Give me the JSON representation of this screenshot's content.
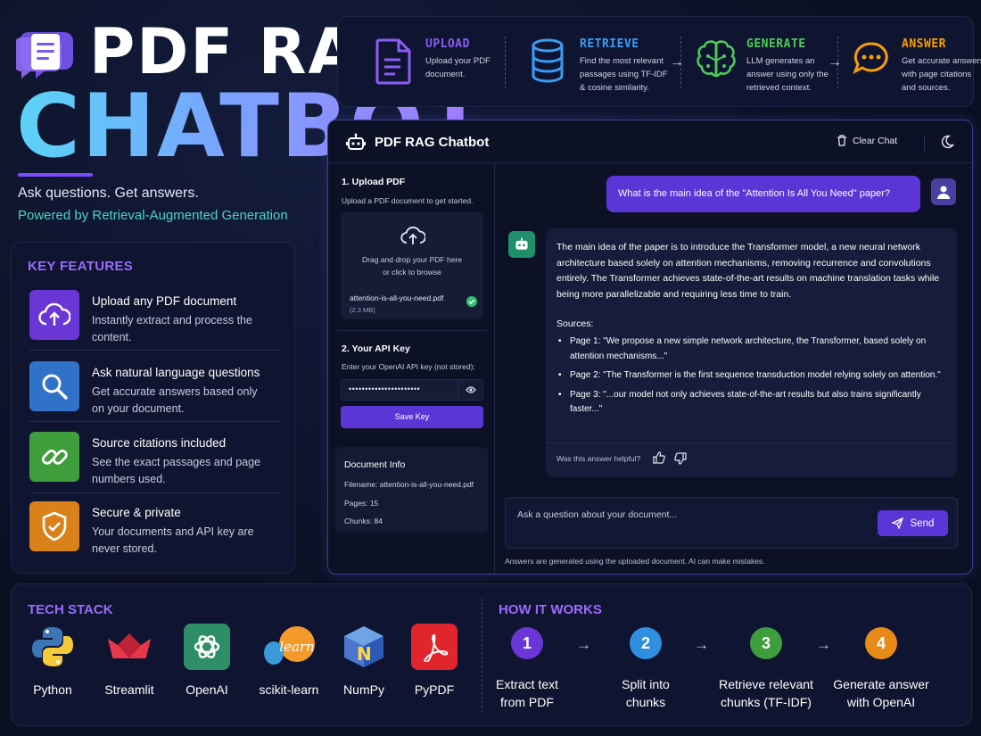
{
  "hero": {
    "line1": "PDF RAG",
    "line2": "CHATBOT",
    "tagline": "Ask questions. Get answers.",
    "powered": "Powered by Retrieval-Augmented Generation"
  },
  "pipeline": [
    {
      "title": "UPLOAD",
      "desc": [
        "Upload your PDF",
        "document."
      ],
      "color": "#8b5cf6"
    },
    {
      "title": "RETRIEVE",
      "desc": [
        "Find the most relevant",
        "passages using TF-IDF",
        "& cosine similarity."
      ],
      "color": "#3b9cf5"
    },
    {
      "title": "GENERATE",
      "desc": [
        "LLM generates an",
        "answer using only the",
        "retrieved context."
      ],
      "color": "#4fc95a"
    },
    {
      "title": "ANSWER",
      "desc": [
        "Get accurate answers",
        "with page citations",
        "and sources."
      ],
      "color": "#f59e0b"
    }
  ],
  "features": {
    "title": "KEY FEATURES",
    "items": [
      {
        "title": "Upload any PDF document",
        "desc": "Instantly extract and process the content.",
        "icon": "cloud-upload-icon",
        "color": "#6a36d6"
      },
      {
        "title": "Ask natural language questions",
        "desc": "Get accurate answers based only on your document.",
        "icon": "search-icon",
        "color": "#2f72c8"
      },
      {
        "title": "Source citations included",
        "desc": "See the exact passages and page numbers used.",
        "icon": "link-icon",
        "color": "#3e9e3c"
      },
      {
        "title": "Secure & private",
        "desc": "Your documents and API key are never stored.",
        "icon": "shield-check-icon",
        "color": "#d9821a"
      }
    ]
  },
  "app": {
    "title": "PDF RAG Chatbot",
    "clear_label": "Clear Chat",
    "sidebar": {
      "upload_heading": "1. Upload PDF",
      "upload_desc": "Upload a PDF document to get started.",
      "drop_line1": "Drag and drop your PDF here",
      "drop_line2": "or click to browse",
      "file_name": "attention-is-all-you-need.pdf",
      "file_size": "(2.3 MB)",
      "api_heading": "2. Your API Key",
      "api_desc": "Enter your OpenAI API key (not stored):",
      "api_value": "••••••••••••••••••••••",
      "save_label": "Save Key",
      "doc_heading": "Document Info",
      "doc_filename": "Filename:  attention-is-all-you-need.pdf",
      "doc_pages": "Pages:  15",
      "doc_chunks": "Chunks:  84"
    },
    "chat": {
      "user_msg": "What is the main idea of the \"Attention Is All You Need\" paper?",
      "bot_main": "The main idea of the paper is to introduce the Transformer model, a new neural network architecture based solely on attention mechanisms, removing recurrence and convolutions entirely. The Transformer achieves state-of-the-art results on machine translation tasks while being more parallelizable and requiring less time to train.",
      "sources_label": "Sources:",
      "sources": [
        "Page 1:  \"We propose a new simple network architecture, the Transformer, based solely on attention mechanisms...\"",
        "Page 2:  \"The Transformer is the first sequence transduction model relying solely on attention.\"",
        "Page 3:  \"...our model not only achieves state-of-the-art results but also trains significantly faster...\""
      ],
      "helpful": "Was this answer helpful?",
      "input_placeholder": "Ask a question about your document...",
      "send_label": "Send",
      "disclaimer": "Answers are generated using the uploaded document. AI can make mistakes."
    }
  },
  "tech_stack": {
    "title": "TECH STACK",
    "items": [
      {
        "label": "Python",
        "icon": "python-icon"
      },
      {
        "label": "Streamlit",
        "icon": "streamlit-icon"
      },
      {
        "label": "OpenAI",
        "icon": "openai-icon"
      },
      {
        "label": "scikit-learn",
        "icon": "scikit-learn-icon"
      },
      {
        "label": "NumPy",
        "icon": "numpy-icon"
      },
      {
        "label": "PyPDF",
        "icon": "pypdf-icon"
      }
    ]
  },
  "how_it_works": {
    "title": "HOW IT WORKS",
    "steps": [
      {
        "num": "1",
        "label": "Extract text\nfrom PDF",
        "color": "#6a36d6"
      },
      {
        "num": "2",
        "label": "Split into\nchunks",
        "color": "#2f8fe0"
      },
      {
        "num": "3",
        "label": "Retrieve relevant\nchunks (TF-IDF)",
        "color": "#3e9e3c"
      },
      {
        "num": "4",
        "label": "Generate answer\nwith OpenAI",
        "color": "#e88a1a"
      }
    ]
  }
}
